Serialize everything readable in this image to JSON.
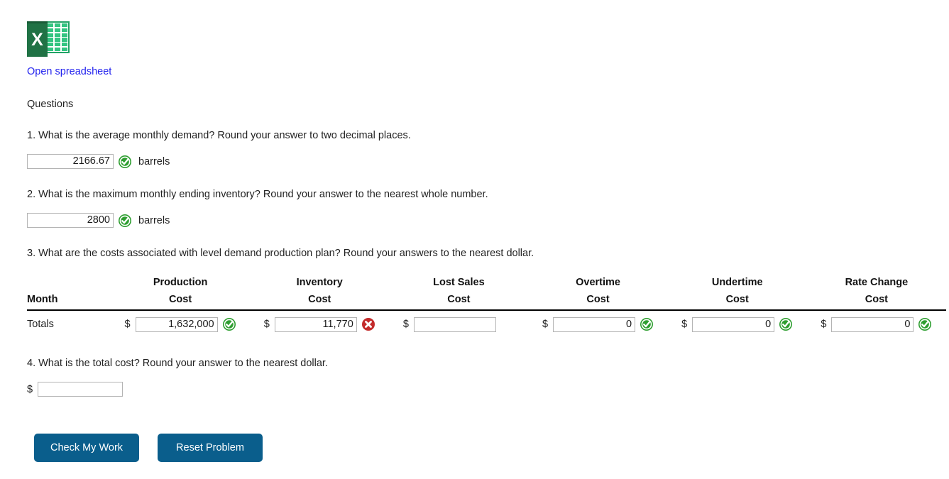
{
  "spreadsheet": {
    "icon_name": "excel-file-icon",
    "icon_letter": "X",
    "link_label": "Open spreadsheet"
  },
  "section": {
    "heading": "Questions"
  },
  "colors": {
    "link": "#2222ee",
    "button": "#0a5e8c",
    "correct": "#2e9e30",
    "incorrect": "#c32b2b",
    "excel_green": "#207245"
  },
  "questions": [
    {
      "prompt": "1. What is the average monthly demand? Round your answer to two decimal places.",
      "value": "2166.67",
      "unit": "barrels",
      "status": "correct"
    },
    {
      "prompt": "2. What is the maximum monthly ending inventory? Round your answer to the nearest whole number.",
      "value": "2800",
      "unit": "barrels",
      "status": "correct"
    },
    {
      "prompt": "3. What are the costs associated with level demand production plan? Round your answers to the nearest dollar.",
      "value": "",
      "unit": "",
      "status": "none"
    },
    {
      "prompt": "4. What is the total cost? Round your answer to the nearest dollar.",
      "value": "",
      "unit": "",
      "status": "none",
      "currency_symbol": "$"
    }
  ],
  "cost_table": {
    "columns": [
      {
        "line1": "",
        "line2": "Month"
      },
      {
        "line1": "Production",
        "line2": "Cost"
      },
      {
        "line1": "Inventory",
        "line2": "Cost"
      },
      {
        "line1": "Lost Sales",
        "line2": "Cost"
      },
      {
        "line1": "Overtime",
        "line2": "Cost"
      },
      {
        "line1": "Undertime",
        "line2": "Cost"
      },
      {
        "line1": "Rate Change",
        "line2": "Cost"
      }
    ],
    "row_label": "Totals",
    "currency_symbol": "$",
    "cells": [
      {
        "name": "production-cost",
        "value": "1,632,000",
        "status": "correct"
      },
      {
        "name": "inventory-cost",
        "value": "11,770",
        "status": "incorrect"
      },
      {
        "name": "lost-sales-cost",
        "value": "",
        "status": "none"
      },
      {
        "name": "overtime-cost",
        "value": "0",
        "status": "correct"
      },
      {
        "name": "undertime-cost",
        "value": "0",
        "status": "correct"
      },
      {
        "name": "rate-change-cost",
        "value": "0",
        "status": "correct"
      }
    ]
  },
  "buttons": {
    "check": "Check My Work",
    "reset": "Reset Problem"
  }
}
